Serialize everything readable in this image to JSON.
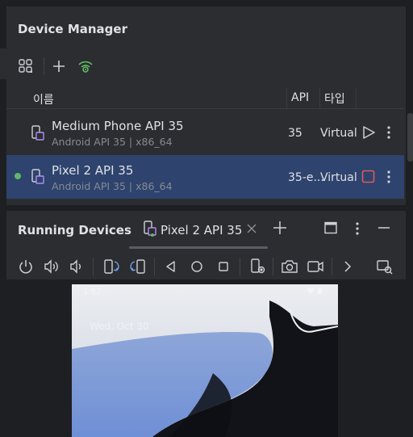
{
  "device_manager": {
    "title": "Device Manager",
    "toolbar": {
      "group_icon": "device-group-icon",
      "add_icon": "plus-icon",
      "pair_icon": "wifi-pair-icon"
    },
    "columns": {
      "name": "이름",
      "api": "API",
      "type": "타입"
    },
    "devices": [
      {
        "name": "Medium Phone API 35",
        "subtitle": "Android API 35 | x86_64",
        "api": "35",
        "type": "Virtual",
        "running": false,
        "action_icon": "play-icon"
      },
      {
        "name": "Pixel 2 API 35",
        "subtitle": "Android API 35 | x86_64",
        "api": "35-e...",
        "type": "Virtual",
        "running": true,
        "action_icon": "stop-icon"
      }
    ]
  },
  "running_devices": {
    "title": "Running Devices",
    "tab": {
      "label": "Pixel 2 API 35"
    },
    "toolbar_icons": [
      "power-icon",
      "volume-up-icon",
      "volume-down-icon",
      "rotate-left-icon",
      "rotate-right-icon",
      "back-icon",
      "home-icon",
      "overview-icon",
      "device-settings-icon",
      "screenshot-icon",
      "screen-record-icon",
      "more-chevron-icon",
      "snapshot-icon"
    ],
    "phone": {
      "time": "1:52",
      "date": "Wed, Oct 30"
    }
  },
  "colors": {
    "accent_selected_row": "#2e436e",
    "running_dot": "#5fb865",
    "stop_button": "#db5c5c",
    "pair_icon": "#5fb865"
  }
}
